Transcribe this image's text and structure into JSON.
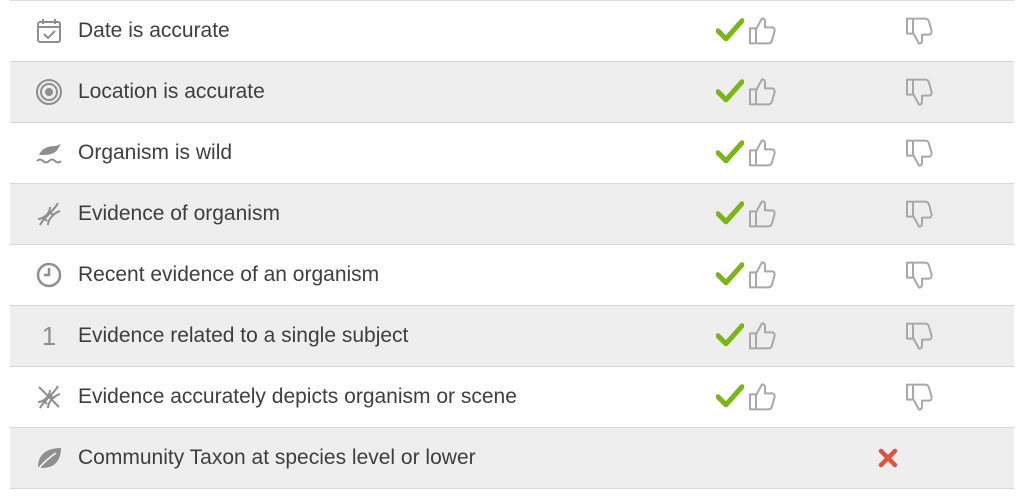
{
  "rows": [
    {
      "icon": "calendar-icon",
      "label": "Date is accurate",
      "status": "agree"
    },
    {
      "icon": "target-icon",
      "label": "Location is accurate",
      "status": "agree"
    },
    {
      "icon": "wild-bird-icon",
      "label": "Organism is wild",
      "status": "agree"
    },
    {
      "icon": "dna-icon",
      "label": "Evidence of organism",
      "status": "agree"
    },
    {
      "icon": "clock-icon",
      "label": "Recent evidence of an organism",
      "status": "agree"
    },
    {
      "icon": "number-one-icon",
      "icon_text": "1",
      "label": "Evidence related to a single subject",
      "status": "agree"
    },
    {
      "icon": "dna-icon",
      "label": "Evidence accurately depicts organism or scene",
      "status": "agree"
    },
    {
      "icon": "leaf-icon",
      "label": "Community Taxon at species level or lower",
      "status": "fail"
    }
  ],
  "colors": {
    "check": "#7cb518",
    "x": "#e0523f",
    "icon": "#8f8f8f",
    "text": "#3e3e3e",
    "row_alt": "#eeeeee"
  }
}
